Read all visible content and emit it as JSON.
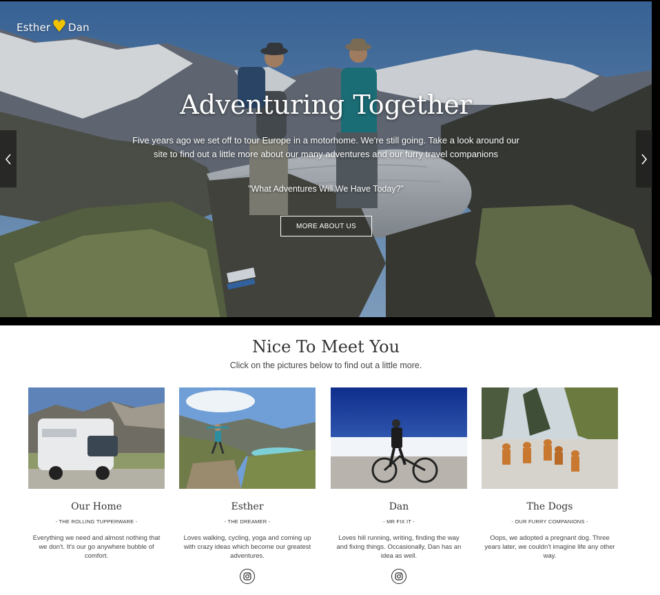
{
  "logo": {
    "left": "Esther",
    "heart": "♥",
    "right": "Dan"
  },
  "hero": {
    "title": "Adventuring Together",
    "text": "Five years ago we set off to tour Europe in a motorhome. We're still going. Take a look around our site to find out a little more about our many adventures and our furry travel companions",
    "quote": "\"What Adventures Will We Have Today?\"",
    "button": "MORE ABOUT US",
    "prev_icon": "chevron-left-icon",
    "next_icon": "chevron-right-icon"
  },
  "intro": {
    "title": "Nice To Meet You",
    "subtitle": "Click on the pictures below to find out a little more."
  },
  "cards": [
    {
      "name": "Our Home",
      "tag": "- THE ROLLING TUPPERWARE -",
      "desc": "Everything we need and almost nothing that we don't. It's our go anywhere bubble of comfort.",
      "icon": ""
    },
    {
      "name": "Esther",
      "tag": "- THE DREAMER -",
      "desc": "Loves walking, cycling, yoga and coming up with crazy ideas which become our greatest adventures.",
      "icon": "instagram-icon"
    },
    {
      "name": "Dan",
      "tag": "- MR FIX IT -",
      "desc": "Loves hill running, writing, finding the way and fixing things. Occasionally, Dan has an idea as well.",
      "icon": "instagram-icon"
    },
    {
      "name": "The Dogs",
      "tag": "- OUR FURRY COMPANIONS -",
      "desc": "Oops, we adopted a pregnant dog. Three years later, we couldn't imagine life any other way.",
      "icon": ""
    }
  ],
  "colors": {
    "heart": "#f2c200",
    "text": "#333333"
  }
}
